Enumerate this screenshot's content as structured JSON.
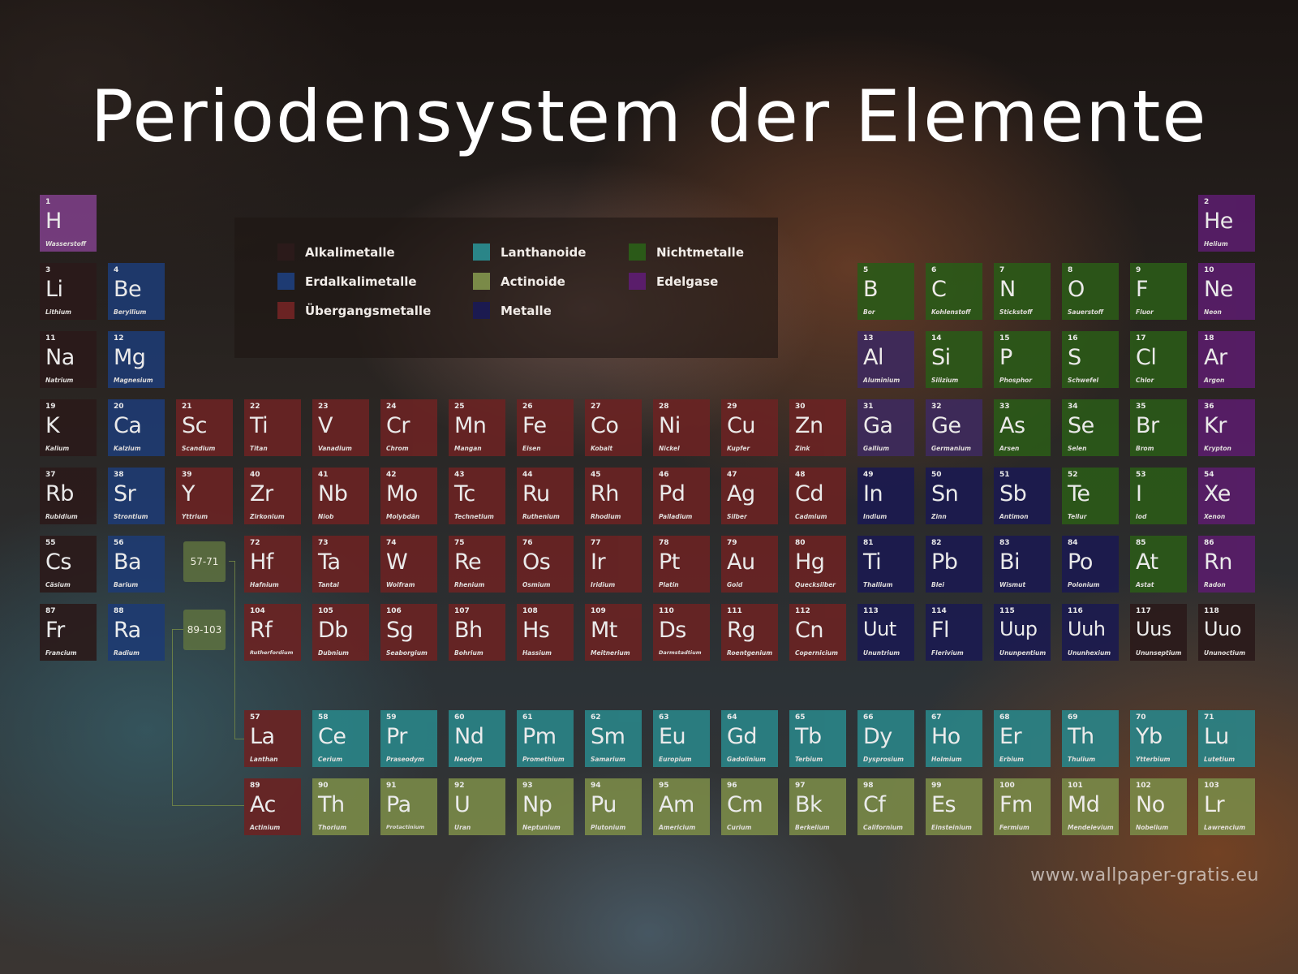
{
  "title": "Periodensystem der Elemente",
  "footer": "www.wallpaper-gratis.eu",
  "colors": {
    "alkali": "#2b1a1a",
    "erdalkali": "#1e3b73",
    "uebergang": "#6b2323",
    "lanthanoid": "#2a8588",
    "actinoid": "#7a8a48",
    "metall": "#1b1a50",
    "nichtmetall": "#2b5a18",
    "edelgas": "#5a1d6b",
    "wasserstoff": "#7c3f86",
    "halbmetall": "#3e2a5e"
  },
  "legend": [
    {
      "label": "Alkalimetalle",
      "cat": "alkali"
    },
    {
      "label": "Erdalkalimetalle",
      "cat": "erdalkali"
    },
    {
      "label": "Übergangsmetalle",
      "cat": "uebergang"
    },
    {
      "label": "Lanthanoide",
      "cat": "lanthanoid"
    },
    {
      "label": "Actinoide",
      "cat": "actinoid"
    },
    {
      "label": "Metalle",
      "cat": "metall"
    },
    {
      "label": "Nichtmetalle",
      "cat": "nichtmetall"
    },
    {
      "label": "Edelgase",
      "cat": "edelgas"
    }
  ],
  "refs": [
    "57-71",
    "89-103"
  ],
  "elements": [
    {
      "n": 1,
      "sym": "H",
      "name": "Wasserstoff",
      "row": 1,
      "col": 1,
      "cat": "wasserstoff"
    },
    {
      "n": 2,
      "sym": "He",
      "name": "Helium",
      "row": 1,
      "col": 18,
      "cat": "edelgas"
    },
    {
      "n": 3,
      "sym": "Li",
      "name": "Lithium",
      "row": 2,
      "col": 1,
      "cat": "alkali"
    },
    {
      "n": 4,
      "sym": "Be",
      "name": "Beryllium",
      "row": 2,
      "col": 2,
      "cat": "erdalkali"
    },
    {
      "n": 5,
      "sym": "B",
      "name": "Bor",
      "row": 2,
      "col": 13,
      "cat": "nichtmetall"
    },
    {
      "n": 6,
      "sym": "C",
      "name": "Kohlenstoff",
      "row": 2,
      "col": 14,
      "cat": "nichtmetall"
    },
    {
      "n": 7,
      "sym": "N",
      "name": "Stickstoff",
      "row": 2,
      "col": 15,
      "cat": "nichtmetall"
    },
    {
      "n": 8,
      "sym": "O",
      "name": "Sauerstoff",
      "row": 2,
      "col": 16,
      "cat": "nichtmetall"
    },
    {
      "n": 9,
      "sym": "F",
      "name": "Fluor",
      "row": 2,
      "col": 17,
      "cat": "nichtmetall"
    },
    {
      "n": 10,
      "sym": "Ne",
      "name": "Neon",
      "row": 2,
      "col": 18,
      "cat": "edelgas"
    },
    {
      "n": 11,
      "sym": "Na",
      "name": "Natrium",
      "row": 3,
      "col": 1,
      "cat": "alkali"
    },
    {
      "n": 12,
      "sym": "Mg",
      "name": "Magnesium",
      "row": 3,
      "col": 2,
      "cat": "erdalkali"
    },
    {
      "n": 13,
      "sym": "Al",
      "name": "Aluminium",
      "row": 3,
      "col": 13,
      "cat": "halbmetall"
    },
    {
      "n": 14,
      "sym": "Si",
      "name": "Silizium",
      "row": 3,
      "col": 14,
      "cat": "nichtmetall"
    },
    {
      "n": 15,
      "sym": "P",
      "name": "Phosphor",
      "row": 3,
      "col": 15,
      "cat": "nichtmetall"
    },
    {
      "n": 16,
      "sym": "S",
      "name": "Schwefel",
      "row": 3,
      "col": 16,
      "cat": "nichtmetall"
    },
    {
      "n": 17,
      "sym": "Cl",
      "name": "Chlor",
      "row": 3,
      "col": 17,
      "cat": "nichtmetall"
    },
    {
      "n": 18,
      "sym": "Ar",
      "name": "Argon",
      "row": 3,
      "col": 18,
      "cat": "edelgas"
    },
    {
      "n": 19,
      "sym": "K",
      "name": "Kalium",
      "row": 4,
      "col": 1,
      "cat": "alkali"
    },
    {
      "n": 20,
      "sym": "Ca",
      "name": "Kalzium",
      "row": 4,
      "col": 2,
      "cat": "erdalkali"
    },
    {
      "n": 21,
      "sym": "Sc",
      "name": "Scandium",
      "row": 4,
      "col": 3,
      "cat": "uebergang"
    },
    {
      "n": 22,
      "sym": "Ti",
      "name": "Titan",
      "row": 4,
      "col": 4,
      "cat": "uebergang"
    },
    {
      "n": 23,
      "sym": "V",
      "name": "Vanadium",
      "row": 4,
      "col": 5,
      "cat": "uebergang"
    },
    {
      "n": 24,
      "sym": "Cr",
      "name": "Chrom",
      "row": 4,
      "col": 6,
      "cat": "uebergang"
    },
    {
      "n": 25,
      "sym": "Mn",
      "name": "Mangan",
      "row": 4,
      "col": 7,
      "cat": "uebergang"
    },
    {
      "n": 26,
      "sym": "Fe",
      "name": "Eisen",
      "row": 4,
      "col": 8,
      "cat": "uebergang"
    },
    {
      "n": 27,
      "sym": "Co",
      "name": "Kobalt",
      "row": 4,
      "col": 9,
      "cat": "uebergang"
    },
    {
      "n": 28,
      "sym": "Ni",
      "name": "Nickel",
      "row": 4,
      "col": 10,
      "cat": "uebergang"
    },
    {
      "n": 29,
      "sym": "Cu",
      "name": "Kupfer",
      "row": 4,
      "col": 11,
      "cat": "uebergang"
    },
    {
      "n": 30,
      "sym": "Zn",
      "name": "Zink",
      "row": 4,
      "col": 12,
      "cat": "uebergang"
    },
    {
      "n": 31,
      "sym": "Ga",
      "name": "Gallium",
      "row": 4,
      "col": 13,
      "cat": "halbmetall"
    },
    {
      "n": 32,
      "sym": "Ge",
      "name": "Germanium",
      "row": 4,
      "col": 14,
      "cat": "halbmetall"
    },
    {
      "n": 33,
      "sym": "As",
      "name": "Arsen",
      "row": 4,
      "col": 15,
      "cat": "nichtmetall"
    },
    {
      "n": 34,
      "sym": "Se",
      "name": "Selen",
      "row": 4,
      "col": 16,
      "cat": "nichtmetall"
    },
    {
      "n": 35,
      "sym": "Br",
      "name": "Brom",
      "row": 4,
      "col": 17,
      "cat": "nichtmetall"
    },
    {
      "n": 36,
      "sym": "Kr",
      "name": "Krypton",
      "row": 4,
      "col": 18,
      "cat": "edelgas"
    },
    {
      "n": 37,
      "sym": "Rb",
      "name": "Rubidium",
      "row": 5,
      "col": 1,
      "cat": "alkali"
    },
    {
      "n": 38,
      "sym": "Sr",
      "name": "Strontium",
      "row": 5,
      "col": 2,
      "cat": "erdalkali"
    },
    {
      "n": 39,
      "sym": "Y",
      "name": "Yttrium",
      "row": 5,
      "col": 3,
      "cat": "uebergang"
    },
    {
      "n": 40,
      "sym": "Zr",
      "name": "Zirkonium",
      "row": 5,
      "col": 4,
      "cat": "uebergang"
    },
    {
      "n": 41,
      "sym": "Nb",
      "name": "Niob",
      "row": 5,
      "col": 5,
      "cat": "uebergang"
    },
    {
      "n": 42,
      "sym": "Mo",
      "name": "Molybdän",
      "row": 5,
      "col": 6,
      "cat": "uebergang"
    },
    {
      "n": 43,
      "sym": "Tc",
      "name": "Technetium",
      "row": 5,
      "col": 7,
      "cat": "uebergang"
    },
    {
      "n": 44,
      "sym": "Ru",
      "name": "Ruthenium",
      "row": 5,
      "col": 8,
      "cat": "uebergang"
    },
    {
      "n": 45,
      "sym": "Rh",
      "name": "Rhodium",
      "row": 5,
      "col": 9,
      "cat": "uebergang"
    },
    {
      "n": 46,
      "sym": "Pd",
      "name": "Palladium",
      "row": 5,
      "col": 10,
      "cat": "uebergang"
    },
    {
      "n": 47,
      "sym": "Ag",
      "name": "Silber",
      "row": 5,
      "col": 11,
      "cat": "uebergang"
    },
    {
      "n": 48,
      "sym": "Cd",
      "name": "Cadmium",
      "row": 5,
      "col": 12,
      "cat": "uebergang"
    },
    {
      "n": 49,
      "sym": "In",
      "name": "Indium",
      "row": 5,
      "col": 13,
      "cat": "metall"
    },
    {
      "n": 50,
      "sym": "Sn",
      "name": "Zinn",
      "row": 5,
      "col": 14,
      "cat": "metall"
    },
    {
      "n": 51,
      "sym": "Sb",
      "name": "Antimon",
      "row": 5,
      "col": 15,
      "cat": "metall"
    },
    {
      "n": 52,
      "sym": "Te",
      "name": "Tellur",
      "row": 5,
      "col": 16,
      "cat": "nichtmetall"
    },
    {
      "n": 53,
      "sym": "I",
      "name": "Iod",
      "row": 5,
      "col": 17,
      "cat": "nichtmetall"
    },
    {
      "n": 54,
      "sym": "Xe",
      "name": "Xenon",
      "row": 5,
      "col": 18,
      "cat": "edelgas"
    },
    {
      "n": 55,
      "sym": "Cs",
      "name": "Cäsium",
      "row": 6,
      "col": 1,
      "cat": "alkali"
    },
    {
      "n": 56,
      "sym": "Ba",
      "name": "Barium",
      "row": 6,
      "col": 2,
      "cat": "erdalkali"
    },
    {
      "n": 72,
      "sym": "Hf",
      "name": "Hafnium",
      "row": 6,
      "col": 4,
      "cat": "uebergang"
    },
    {
      "n": 73,
      "sym": "Ta",
      "name": "Tantal",
      "row": 6,
      "col": 5,
      "cat": "uebergang"
    },
    {
      "n": 74,
      "sym": "W",
      "name": "Wolfram",
      "row": 6,
      "col": 6,
      "cat": "uebergang"
    },
    {
      "n": 75,
      "sym": "Re",
      "name": "Rhenium",
      "row": 6,
      "col": 7,
      "cat": "uebergang"
    },
    {
      "n": 76,
      "sym": "Os",
      "name": "Osmium",
      "row": 6,
      "col": 8,
      "cat": "uebergang"
    },
    {
      "n": 77,
      "sym": "Ir",
      "name": "Iridium",
      "row": 6,
      "col": 9,
      "cat": "uebergang"
    },
    {
      "n": 78,
      "sym": "Pt",
      "name": "Platin",
      "row": 6,
      "col": 10,
      "cat": "uebergang"
    },
    {
      "n": 79,
      "sym": "Au",
      "name": "Gold",
      "row": 6,
      "col": 11,
      "cat": "uebergang"
    },
    {
      "n": 80,
      "sym": "Hg",
      "name": "Quecksilber",
      "row": 6,
      "col": 12,
      "cat": "uebergang"
    },
    {
      "n": 81,
      "sym": "Ti",
      "name": "Thallium",
      "row": 6,
      "col": 13,
      "cat": "metall"
    },
    {
      "n": 82,
      "sym": "Pb",
      "name": "Blei",
      "row": 6,
      "col": 14,
      "cat": "metall"
    },
    {
      "n": 83,
      "sym": "Bi",
      "name": "Wismut",
      "row": 6,
      "col": 15,
      "cat": "metall"
    },
    {
      "n": 84,
      "sym": "Po",
      "name": "Polonium",
      "row": 6,
      "col": 16,
      "cat": "metall"
    },
    {
      "n": 85,
      "sym": "At",
      "name": "Astat",
      "row": 6,
      "col": 17,
      "cat": "nichtmetall"
    },
    {
      "n": 86,
      "sym": "Rn",
      "name": "Radon",
      "row": 6,
      "col": 18,
      "cat": "edelgas"
    },
    {
      "n": 87,
      "sym": "Fr",
      "name": "Francium",
      "row": 7,
      "col": 1,
      "cat": "alkali"
    },
    {
      "n": 88,
      "sym": "Ra",
      "name": "Radium",
      "row": 7,
      "col": 2,
      "cat": "erdalkali"
    },
    {
      "n": 104,
      "sym": "Rf",
      "name": "Rutherfordium",
      "row": 7,
      "col": 4,
      "cat": "uebergang"
    },
    {
      "n": 105,
      "sym": "Db",
      "name": "Dubnium",
      "row": 7,
      "col": 5,
      "cat": "uebergang"
    },
    {
      "n": 106,
      "sym": "Sg",
      "name": "Seaborgium",
      "row": 7,
      "col": 6,
      "cat": "uebergang"
    },
    {
      "n": 107,
      "sym": "Bh",
      "name": "Bohrium",
      "row": 7,
      "col": 7,
      "cat": "uebergang"
    },
    {
      "n": 108,
      "sym": "Hs",
      "name": "Hassium",
      "row": 7,
      "col": 8,
      "cat": "uebergang"
    },
    {
      "n": 109,
      "sym": "Mt",
      "name": "Meitnerium",
      "row": 7,
      "col": 9,
      "cat": "uebergang"
    },
    {
      "n": 110,
      "sym": "Ds",
      "name": "Darmstadtium",
      "row": 7,
      "col": 10,
      "cat": "uebergang"
    },
    {
      "n": 111,
      "sym": "Rg",
      "name": "Roentgenium",
      "row": 7,
      "col": 11,
      "cat": "uebergang"
    },
    {
      "n": 112,
      "sym": "Cn",
      "name": "Copernicium",
      "row": 7,
      "col": 12,
      "cat": "uebergang"
    },
    {
      "n": 113,
      "sym": "Uut",
      "name": "Ununtrium",
      "row": 7,
      "col": 13,
      "cat": "metall"
    },
    {
      "n": 114,
      "sym": "Fl",
      "name": "Flerivium",
      "row": 7,
      "col": 14,
      "cat": "metall"
    },
    {
      "n": 115,
      "sym": "Uup",
      "name": "Ununpentium",
      "row": 7,
      "col": 15,
      "cat": "metall"
    },
    {
      "n": 116,
      "sym": "Uuh",
      "name": "Ununhexium",
      "row": 7,
      "col": 16,
      "cat": "metall"
    },
    {
      "n": 117,
      "sym": "Uus",
      "name": "Ununseptium",
      "row": 7,
      "col": 17,
      "cat": "alkali"
    },
    {
      "n": 118,
      "sym": "Uuo",
      "name": "Ununoctium",
      "row": 7,
      "col": 18,
      "cat": "alkali"
    },
    {
      "n": 57,
      "sym": "La",
      "name": "Lanthan",
      "row": 9,
      "col": 4,
      "cat": "uebergang"
    },
    {
      "n": 58,
      "sym": "Ce",
      "name": "Cerium",
      "row": 9,
      "col": 5,
      "cat": "lanthanoid"
    },
    {
      "n": 59,
      "sym": "Pr",
      "name": "Praseodym",
      "row": 9,
      "col": 6,
      "cat": "lanthanoid"
    },
    {
      "n": 60,
      "sym": "Nd",
      "name": "Neodym",
      "row": 9,
      "col": 7,
      "cat": "lanthanoid"
    },
    {
      "n": 61,
      "sym": "Pm",
      "name": "Promethium",
      "row": 9,
      "col": 8,
      "cat": "lanthanoid"
    },
    {
      "n": 62,
      "sym": "Sm",
      "name": "Samarium",
      "row": 9,
      "col": 9,
      "cat": "lanthanoid"
    },
    {
      "n": 63,
      "sym": "Eu",
      "name": "Europium",
      "row": 9,
      "col": 10,
      "cat": "lanthanoid"
    },
    {
      "n": 64,
      "sym": "Gd",
      "name": "Gadolinium",
      "row": 9,
      "col": 11,
      "cat": "lanthanoid"
    },
    {
      "n": 65,
      "sym": "Tb",
      "name": "Terbium",
      "row": 9,
      "col": 12,
      "cat": "lanthanoid"
    },
    {
      "n": 66,
      "sym": "Dy",
      "name": "Dysprosium",
      "row": 9,
      "col": 13,
      "cat": "lanthanoid"
    },
    {
      "n": 67,
      "sym": "Ho",
      "name": "Holmium",
      "row": 9,
      "col": 14,
      "cat": "lanthanoid"
    },
    {
      "n": 68,
      "sym": "Er",
      "name": "Erbium",
      "row": 9,
      "col": 15,
      "cat": "lanthanoid"
    },
    {
      "n": 69,
      "sym": "Th",
      "name": "Thulium",
      "row": 9,
      "col": 16,
      "cat": "lanthanoid"
    },
    {
      "n": 70,
      "sym": "Yb",
      "name": "Ytterbium",
      "row": 9,
      "col": 17,
      "cat": "lanthanoid"
    },
    {
      "n": 71,
      "sym": "Lu",
      "name": "Lutetium",
      "row": 9,
      "col": 18,
      "cat": "lanthanoid"
    },
    {
      "n": 89,
      "sym": "Ac",
      "name": "Actinium",
      "row": 10,
      "col": 4,
      "cat": "uebergang"
    },
    {
      "n": 90,
      "sym": "Th",
      "name": "Thorium",
      "row": 10,
      "col": 5,
      "cat": "actinoid"
    },
    {
      "n": 91,
      "sym": "Pa",
      "name": "Protactinium",
      "row": 10,
      "col": 6,
      "cat": "actinoid"
    },
    {
      "n": 92,
      "sym": "U",
      "name": "Uran",
      "row": 10,
      "col": 7,
      "cat": "actinoid"
    },
    {
      "n": 93,
      "sym": "Np",
      "name": "Neptunium",
      "row": 10,
      "col": 8,
      "cat": "actinoid"
    },
    {
      "n": 94,
      "sym": "Pu",
      "name": "Plutonium",
      "row": 10,
      "col": 9,
      "cat": "actinoid"
    },
    {
      "n": 95,
      "sym": "Am",
      "name": "Americium",
      "row": 10,
      "col": 10,
      "cat": "actinoid"
    },
    {
      "n": 96,
      "sym": "Cm",
      "name": "Curium",
      "row": 10,
      "col": 11,
      "cat": "actinoid"
    },
    {
      "n": 97,
      "sym": "Bk",
      "name": "Berkelium",
      "row": 10,
      "col": 12,
      "cat": "actinoid"
    },
    {
      "n": 98,
      "sym": "Cf",
      "name": "Californium",
      "row": 10,
      "col": 13,
      "cat": "actinoid"
    },
    {
      "n": 99,
      "sym": "Es",
      "name": "Einsteinium",
      "row": 10,
      "col": 14,
      "cat": "actinoid"
    },
    {
      "n": 100,
      "sym": "Fm",
      "name": "Fermium",
      "row": 10,
      "col": 15,
      "cat": "actinoid"
    },
    {
      "n": 101,
      "sym": "Md",
      "name": "Mendelevium",
      "row": 10,
      "col": 16,
      "cat": "actinoid"
    },
    {
      "n": 102,
      "sym": "No",
      "name": "Nobelium",
      "row": 10,
      "col": 17,
      "cat": "actinoid"
    },
    {
      "n": 103,
      "sym": "Lr",
      "name": "Lawrencium",
      "row": 10,
      "col": 18,
      "cat": "actinoid"
    }
  ]
}
